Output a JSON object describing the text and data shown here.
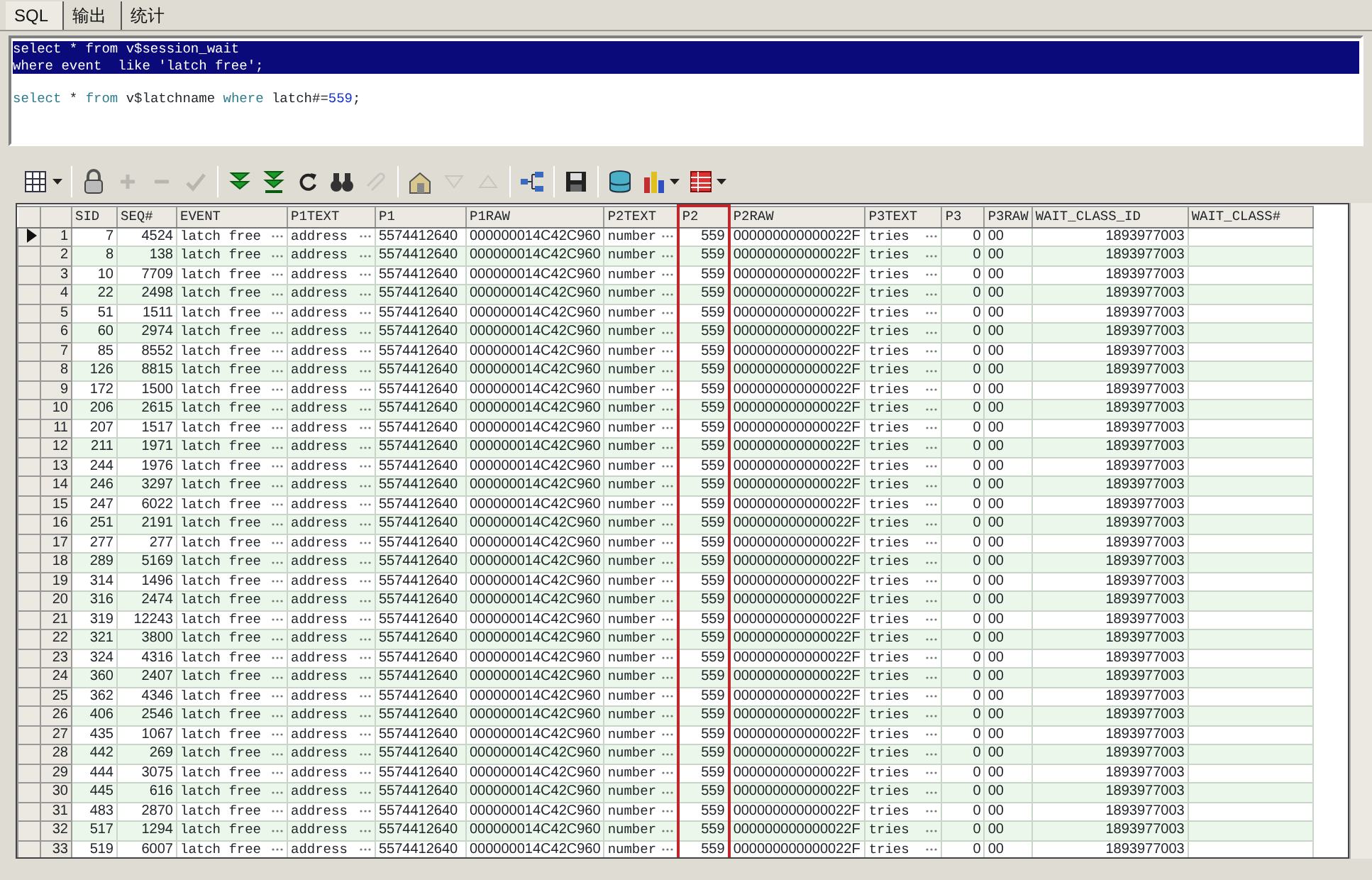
{
  "tabs": [
    {
      "label": "SQL",
      "selected": true
    },
    {
      "label": "输出",
      "selected": false
    },
    {
      "label": "统计",
      "selected": false
    }
  ],
  "editor": {
    "lines": [
      {
        "selected": true,
        "segments": [
          {
            "text": "select * from v$session_wait",
            "kind": "plain"
          }
        ]
      },
      {
        "selected": true,
        "segments": [
          {
            "text": "where event  like 'latch free';",
            "kind": "plain"
          }
        ]
      },
      {
        "selected": false
      },
      {
        "selected": false,
        "segments": [
          {
            "text": "select",
            "kind": "keyword"
          },
          {
            "text": " * ",
            "kind": "plain"
          },
          {
            "text": "from",
            "kind": "keyword"
          },
          {
            "text": " v$latchname ",
            "kind": "plain"
          },
          {
            "text": "where",
            "kind": "keyword"
          },
          {
            "text": " latch#=",
            "kind": "plain"
          },
          {
            "text": "559",
            "kind": "number"
          },
          {
            "text": ";",
            "kind": "plain"
          }
        ]
      }
    ]
  },
  "toolbar": [
    {
      "kind": "grid",
      "dropdown": true,
      "disabled": false
    },
    {
      "kind": "separator"
    },
    {
      "kind": "lock",
      "dropdown": false,
      "disabled": false
    },
    {
      "kind": "plus",
      "dropdown": false,
      "disabled": true
    },
    {
      "kind": "minus",
      "dropdown": false,
      "disabled": true
    },
    {
      "kind": "check",
      "dropdown": false,
      "disabled": true
    },
    {
      "kind": "separator"
    },
    {
      "kind": "fetch-next",
      "dropdown": false,
      "disabled": false
    },
    {
      "kind": "fetch-all",
      "dropdown": false,
      "disabled": false
    },
    {
      "kind": "refresh",
      "dropdown": false,
      "disabled": false
    },
    {
      "kind": "binoculars",
      "dropdown": false,
      "disabled": false
    },
    {
      "kind": "pin",
      "dropdown": false,
      "disabled": true
    },
    {
      "kind": "separator"
    },
    {
      "kind": "house",
      "dropdown": false,
      "disabled": false
    },
    {
      "kind": "triangle-down",
      "dropdown": false,
      "disabled": true
    },
    {
      "kind": "triangle-up",
      "dropdown": false,
      "disabled": true
    },
    {
      "kind": "separator"
    },
    {
      "kind": "tree",
      "dropdown": false,
      "disabled": false
    },
    {
      "kind": "separator"
    },
    {
      "kind": "save",
      "dropdown": false,
      "disabled": false
    },
    {
      "kind": "separator"
    },
    {
      "kind": "database",
      "dropdown": false,
      "disabled": false
    },
    {
      "kind": "chart",
      "dropdown": true,
      "disabled": false
    },
    {
      "kind": "table",
      "dropdown": true,
      "disabled": false
    }
  ],
  "table": {
    "columns": [
      {
        "label": "SID",
        "kind": "number",
        "highlighted": false
      },
      {
        "label": "SEQ#",
        "kind": "number",
        "highlighted": false
      },
      {
        "label": "EVENT",
        "kind": "text_button",
        "highlighted": false
      },
      {
        "label": "P1TEXT",
        "kind": "text_button",
        "highlighted": false
      },
      {
        "label": "P1",
        "kind": "raw",
        "highlighted": false
      },
      {
        "label": "P1RAW",
        "kind": "raw",
        "highlighted": false
      },
      {
        "label": "P2TEXT",
        "kind": "text_button",
        "highlighted": false
      },
      {
        "label": "P2",
        "kind": "number",
        "highlighted": true
      },
      {
        "label": "P2RAW",
        "kind": "raw",
        "highlighted": false
      },
      {
        "label": "P3TEXT",
        "kind": "text_button",
        "highlighted": false
      },
      {
        "label": "P3",
        "kind": "number",
        "highlighted": false
      },
      {
        "label": "P3RAW",
        "kind": "raw",
        "highlighted": false
      },
      {
        "label": "WAIT_CLASS_ID",
        "kind": "number",
        "highlighted": false
      },
      {
        "label": "WAIT_CLASS#",
        "kind": "number",
        "highlighted": false
      }
    ],
    "rows": [
      {
        "number": "1",
        "current": true,
        "cells": [
          "7",
          "4524",
          "latch free",
          "address",
          "5574412640",
          "000000014C42C960",
          "number",
          "559",
          "000000000000022F",
          "tries",
          "0",
          "00",
          "1893977003"
        ]
      },
      {
        "number": "2",
        "current": false,
        "cells": [
          "8",
          "138",
          "latch free",
          "address",
          "5574412640",
          "000000014C42C960",
          "number",
          "559",
          "000000000000022F",
          "tries",
          "0",
          "00",
          "1893977003"
        ]
      },
      {
        "number": "3",
        "current": false,
        "cells": [
          "10",
          "7709",
          "latch free",
          "address",
          "5574412640",
          "000000014C42C960",
          "number",
          "559",
          "000000000000022F",
          "tries",
          "0",
          "00",
          "1893977003"
        ]
      },
      {
        "number": "4",
        "current": false,
        "cells": [
          "22",
          "2498",
          "latch free",
          "address",
          "5574412640",
          "000000014C42C960",
          "number",
          "559",
          "000000000000022F",
          "tries",
          "0",
          "00",
          "1893977003"
        ]
      },
      {
        "number": "5",
        "current": false,
        "cells": [
          "51",
          "1511",
          "latch free",
          "address",
          "5574412640",
          "000000014C42C960",
          "number",
          "559",
          "000000000000022F",
          "tries",
          "0",
          "00",
          "1893977003"
        ]
      },
      {
        "number": "6",
        "current": false,
        "cells": [
          "60",
          "2974",
          "latch free",
          "address",
          "5574412640",
          "000000014C42C960",
          "number",
          "559",
          "000000000000022F",
          "tries",
          "0",
          "00",
          "1893977003"
        ]
      },
      {
        "number": "7",
        "current": false,
        "cells": [
          "85",
          "8552",
          "latch free",
          "address",
          "5574412640",
          "000000014C42C960",
          "number",
          "559",
          "000000000000022F",
          "tries",
          "0",
          "00",
          "1893977003"
        ]
      },
      {
        "number": "8",
        "current": false,
        "cells": [
          "126",
          "8815",
          "latch free",
          "address",
          "5574412640",
          "000000014C42C960",
          "number",
          "559",
          "000000000000022F",
          "tries",
          "0",
          "00",
          "1893977003"
        ]
      },
      {
        "number": "9",
        "current": false,
        "cells": [
          "172",
          "1500",
          "latch free",
          "address",
          "5574412640",
          "000000014C42C960",
          "number",
          "559",
          "000000000000022F",
          "tries",
          "0",
          "00",
          "1893977003"
        ]
      },
      {
        "number": "10",
        "current": false,
        "cells": [
          "206",
          "2615",
          "latch free",
          "address",
          "5574412640",
          "000000014C42C960",
          "number",
          "559",
          "000000000000022F",
          "tries",
          "0",
          "00",
          "1893977003"
        ]
      },
      {
        "number": "11",
        "current": false,
        "cells": [
          "207",
          "1517",
          "latch free",
          "address",
          "5574412640",
          "000000014C42C960",
          "number",
          "559",
          "000000000000022F",
          "tries",
          "0",
          "00",
          "1893977003"
        ]
      },
      {
        "number": "12",
        "current": false,
        "cells": [
          "211",
          "1971",
          "latch free",
          "address",
          "5574412640",
          "000000014C42C960",
          "number",
          "559",
          "000000000000022F",
          "tries",
          "0",
          "00",
          "1893977003"
        ]
      },
      {
        "number": "13",
        "current": false,
        "cells": [
          "244",
          "1976",
          "latch free",
          "address",
          "5574412640",
          "000000014C42C960",
          "number",
          "559",
          "000000000000022F",
          "tries",
          "0",
          "00",
          "1893977003"
        ]
      },
      {
        "number": "14",
        "current": false,
        "cells": [
          "246",
          "3297",
          "latch free",
          "address",
          "5574412640",
          "000000014C42C960",
          "number",
          "559",
          "000000000000022F",
          "tries",
          "0",
          "00",
          "1893977003"
        ]
      },
      {
        "number": "15",
        "current": false,
        "cells": [
          "247",
          "6022",
          "latch free",
          "address",
          "5574412640",
          "000000014C42C960",
          "number",
          "559",
          "000000000000022F",
          "tries",
          "0",
          "00",
          "1893977003"
        ]
      },
      {
        "number": "16",
        "current": false,
        "cells": [
          "251",
          "2191",
          "latch free",
          "address",
          "5574412640",
          "000000014C42C960",
          "number",
          "559",
          "000000000000022F",
          "tries",
          "0",
          "00",
          "1893977003"
        ]
      },
      {
        "number": "17",
        "current": false,
        "cells": [
          "277",
          "277",
          "latch free",
          "address",
          "5574412640",
          "000000014C42C960",
          "number",
          "559",
          "000000000000022F",
          "tries",
          "0",
          "00",
          "1893977003"
        ]
      },
      {
        "number": "18",
        "current": false,
        "cells": [
          "289",
          "5169",
          "latch free",
          "address",
          "5574412640",
          "000000014C42C960",
          "number",
          "559",
          "000000000000022F",
          "tries",
          "0",
          "00",
          "1893977003"
        ]
      },
      {
        "number": "19",
        "current": false,
        "cells": [
          "314",
          "1496",
          "latch free",
          "address",
          "5574412640",
          "000000014C42C960",
          "number",
          "559",
          "000000000000022F",
          "tries",
          "0",
          "00",
          "1893977003"
        ]
      },
      {
        "number": "20",
        "current": false,
        "cells": [
          "316",
          "2474",
          "latch free",
          "address",
          "5574412640",
          "000000014C42C960",
          "number",
          "559",
          "000000000000022F",
          "tries",
          "0",
          "00",
          "1893977003"
        ]
      },
      {
        "number": "21",
        "current": false,
        "cells": [
          "319",
          "12243",
          "latch free",
          "address",
          "5574412640",
          "000000014C42C960",
          "number",
          "559",
          "000000000000022F",
          "tries",
          "0",
          "00",
          "1893977003"
        ]
      },
      {
        "number": "22",
        "current": false,
        "cells": [
          "321",
          "3800",
          "latch free",
          "address",
          "5574412640",
          "000000014C42C960",
          "number",
          "559",
          "000000000000022F",
          "tries",
          "0",
          "00",
          "1893977003"
        ]
      },
      {
        "number": "23",
        "current": false,
        "cells": [
          "324",
          "4316",
          "latch free",
          "address",
          "5574412640",
          "000000014C42C960",
          "number",
          "559",
          "000000000000022F",
          "tries",
          "0",
          "00",
          "1893977003"
        ]
      },
      {
        "number": "24",
        "current": false,
        "cells": [
          "360",
          "2407",
          "latch free",
          "address",
          "5574412640",
          "000000014C42C960",
          "number",
          "559",
          "000000000000022F",
          "tries",
          "0",
          "00",
          "1893977003"
        ]
      },
      {
        "number": "25",
        "current": false,
        "cells": [
          "362",
          "4346",
          "latch free",
          "address",
          "5574412640",
          "000000014C42C960",
          "number",
          "559",
          "000000000000022F",
          "tries",
          "0",
          "00",
          "1893977003"
        ]
      },
      {
        "number": "26",
        "current": false,
        "cells": [
          "406",
          "2546",
          "latch free",
          "address",
          "5574412640",
          "000000014C42C960",
          "number",
          "559",
          "000000000000022F",
          "tries",
          "0",
          "00",
          "1893977003"
        ]
      },
      {
        "number": "27",
        "current": false,
        "cells": [
          "435",
          "1067",
          "latch free",
          "address",
          "5574412640",
          "000000014C42C960",
          "number",
          "559",
          "000000000000022F",
          "tries",
          "0",
          "00",
          "1893977003"
        ]
      },
      {
        "number": "28",
        "current": false,
        "cells": [
          "442",
          "269",
          "latch free",
          "address",
          "5574412640",
          "000000014C42C960",
          "number",
          "559",
          "000000000000022F",
          "tries",
          "0",
          "00",
          "1893977003"
        ]
      },
      {
        "number": "29",
        "current": false,
        "cells": [
          "444",
          "3075",
          "latch free",
          "address",
          "5574412640",
          "000000014C42C960",
          "number",
          "559",
          "000000000000022F",
          "tries",
          "0",
          "00",
          "1893977003"
        ]
      },
      {
        "number": "30",
        "current": false,
        "cells": [
          "445",
          "616",
          "latch free",
          "address",
          "5574412640",
          "000000014C42C960",
          "number",
          "559",
          "000000000000022F",
          "tries",
          "0",
          "00",
          "1893977003"
        ]
      },
      {
        "number": "31",
        "current": false,
        "cells": [
          "483",
          "2870",
          "latch free",
          "address",
          "5574412640",
          "000000014C42C960",
          "number",
          "559",
          "000000000000022F",
          "tries",
          "0",
          "00",
          "1893977003"
        ]
      },
      {
        "number": "32",
        "current": false,
        "cells": [
          "517",
          "1294",
          "latch free",
          "address",
          "5574412640",
          "000000014C42C960",
          "number",
          "559",
          "000000000000022F",
          "tries",
          "0",
          "00",
          "1893977003"
        ]
      },
      {
        "number": "33",
        "current": false,
        "cells": [
          "519",
          "6007",
          "latch free",
          "address",
          "5574412640",
          "000000014C42C960",
          "number",
          "559",
          "000000000000022F",
          "tries",
          "0",
          "00",
          "1893977003"
        ]
      }
    ]
  }
}
